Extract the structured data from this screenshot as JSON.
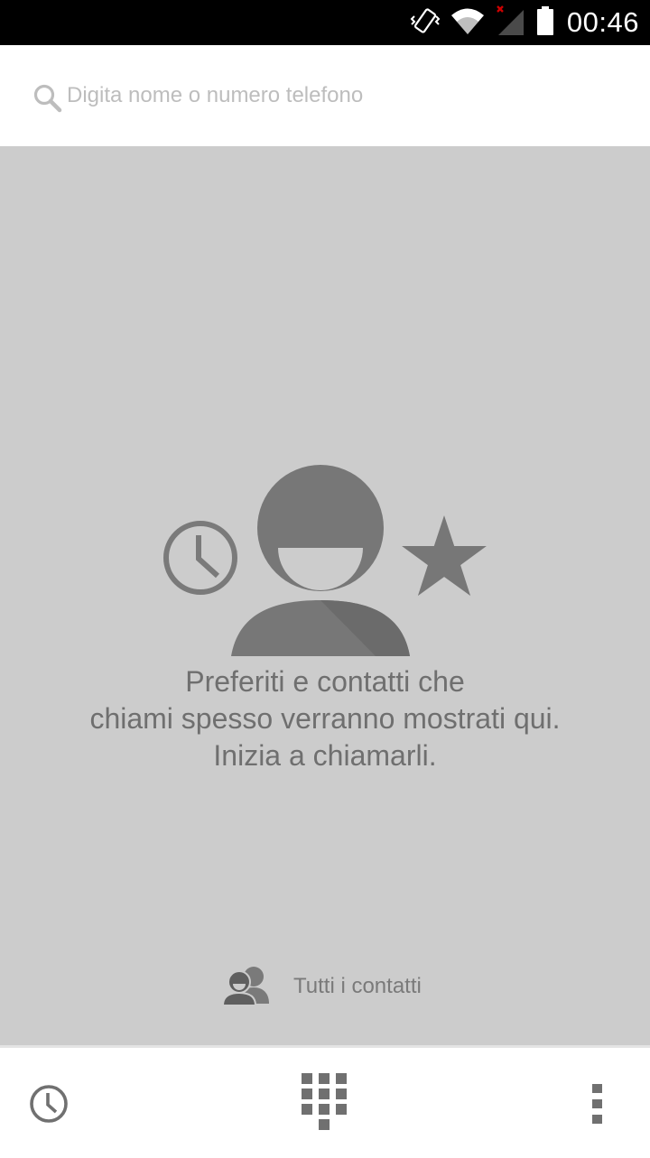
{
  "status_bar": {
    "time": "00:46",
    "icons": [
      "vibrate-icon",
      "wifi-icon",
      "signal-icon",
      "battery-icon"
    ]
  },
  "search": {
    "placeholder": "Digita nome o numero telefono",
    "value": ""
  },
  "empty_state": {
    "line1": "Preferiti e contatti che",
    "line2": "chiami spesso verranno mostrati qui.",
    "line3": "Inizia a chiamarli.",
    "icons": [
      "clock-icon",
      "person-icon",
      "star-icon"
    ]
  },
  "all_contacts": {
    "label": "Tutti i contatti",
    "icon": "contacts-icon"
  },
  "bottom_nav": {
    "items": [
      "call-history-icon",
      "dialpad-icon",
      "overflow-menu-icon"
    ]
  },
  "colors": {
    "background": "#cccccc",
    "illustration": "#7a7a7a",
    "text": "#6f6f6f",
    "status_bar": "#000000",
    "signal_x": "#cc0000"
  }
}
